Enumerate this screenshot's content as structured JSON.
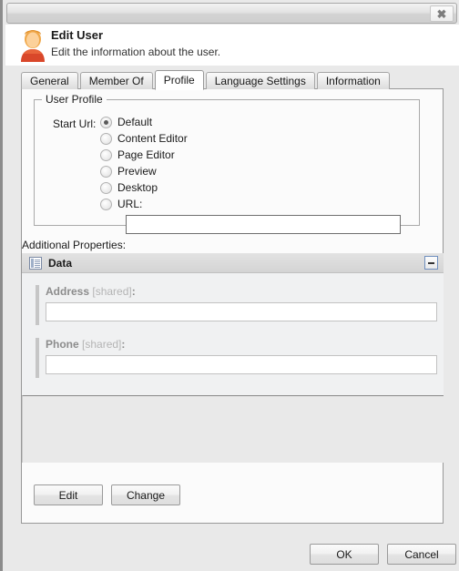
{
  "window": {
    "close_label": "✖"
  },
  "header": {
    "title": "Edit User",
    "subtitle": "Edit the information about the user.",
    "icon": "user-icon"
  },
  "tabs": [
    {
      "label": "General",
      "active": false
    },
    {
      "label": "Member Of",
      "active": false
    },
    {
      "label": "Profile",
      "active": true
    },
    {
      "label": "Language Settings",
      "active": false
    },
    {
      "label": "Information",
      "active": false
    }
  ],
  "user_profile": {
    "legend": "User Profile",
    "start_url_label": "Start Url:",
    "options": [
      {
        "label": "Default",
        "checked": true
      },
      {
        "label": "Content Editor",
        "checked": false
      },
      {
        "label": "Page Editor",
        "checked": false
      },
      {
        "label": "Preview",
        "checked": false
      },
      {
        "label": "Desktop",
        "checked": false
      },
      {
        "label": "URL:",
        "checked": false
      }
    ],
    "url_value": "",
    "url_placeholder": ""
  },
  "additional_properties": {
    "label": "Additional Properties:",
    "section": {
      "title": "Data",
      "icon": "document-list-icon",
      "collapse_icon": "minus-icon",
      "fields": [
        {
          "name": "Address",
          "shared": "[shared]",
          "suffix": ":",
          "value": "",
          "placeholder": ""
        },
        {
          "name": "Phone",
          "shared": "[shared]",
          "suffix": ":",
          "value": "",
          "placeholder": ""
        }
      ]
    }
  },
  "actions": {
    "edit_label": "Edit",
    "change_label": "Change"
  },
  "footer": {
    "ok_label": "OK",
    "cancel_label": "Cancel"
  },
  "colors": {
    "window_bg": "#e9e9e9",
    "panel_bg": "#fbfbfb",
    "data_body_bg": "#f0f1f2",
    "data_header_bg": "#dadada",
    "accent_blue": "#6f8fbe",
    "label_gray": "#8c8c8c",
    "shared_gray": "#b4b4b4"
  }
}
